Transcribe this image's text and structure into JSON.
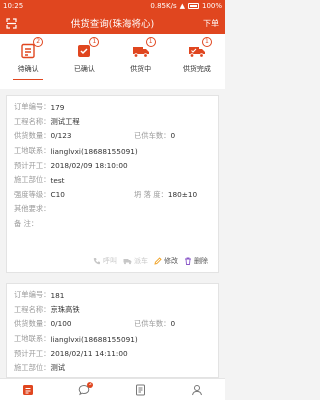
{
  "statusbar": {
    "time": "10:25",
    "net_speed": "0.85K/s",
    "battery": "100%"
  },
  "header": {
    "title": "供货查询(珠海将心)",
    "order_button": "下单"
  },
  "tabs": [
    {
      "label": "待确认",
      "badge": "2"
    },
    {
      "label": "已确认",
      "badge": "1"
    },
    {
      "label": "供货中",
      "badge": "1"
    },
    {
      "label": "供货完成",
      "badge": "1"
    }
  ],
  "cards": [
    {
      "order_label": "订单编号：",
      "order": "179",
      "project_label": "工程名称：",
      "project": "测试工程",
      "supply_label": "供货数量：",
      "supply": "0/123",
      "trucks_label": "已供车数：",
      "trucks": "0",
      "contact_label": "工地联系：",
      "contact": "lianglvxi(18688155091)",
      "start_label": "预计开工：",
      "start": "2018/02/09 18:10:00",
      "part_label": "施工部位：",
      "part": "test",
      "grade_label": "强度等级：",
      "grade": "C10",
      "slump_label": "坍 落 度：",
      "slump": "180±10",
      "other_label": "其他要求：",
      "other": "",
      "remark_label": "备     注：",
      "remark": "",
      "actions": {
        "call": "呼叫",
        "dispatch": "派车",
        "edit": "修改",
        "delete": "删除"
      }
    },
    {
      "order_label": "订单编号：",
      "order": "181",
      "project_label": "工程名称：",
      "project": "京珠高铁",
      "supply_label": "供货数量：",
      "supply": "0/100",
      "trucks_label": "已供车数：",
      "trucks": "0",
      "contact_label": "工地联系：",
      "contact": "lianglvxi(18688155091)",
      "start_label": "预计开工：",
      "start": "2018/02/11 14:11:00",
      "part_label": "施工部位：",
      "part": "测试"
    }
  ],
  "bottom_nav": {
    "messages_badge": "2"
  },
  "colors": {
    "accent": "#e0461f"
  }
}
